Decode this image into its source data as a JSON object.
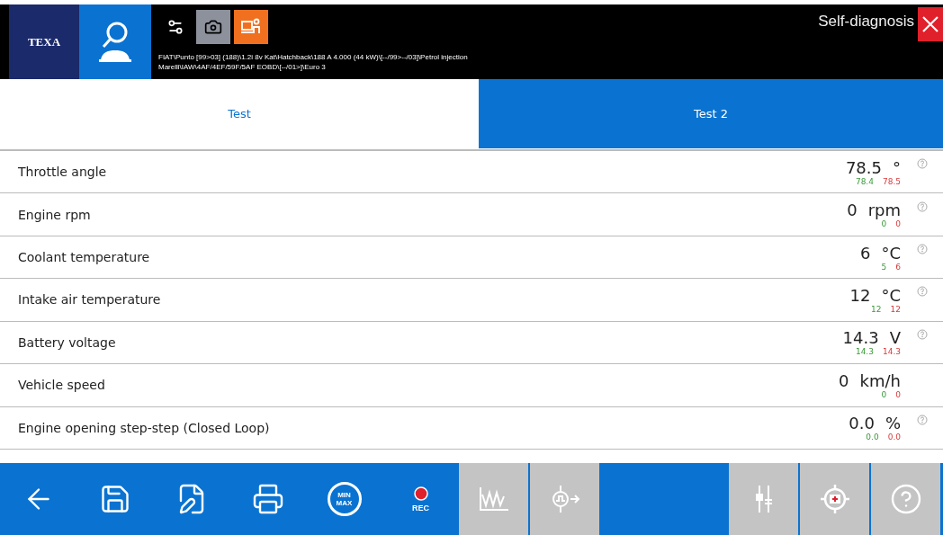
{
  "header": {
    "logo": "TEXA",
    "vehicle_lines": [
      "FIAT\\Punto  [99>03] (188)\\1.2i 8v Kat\\Hatchback\\188 A 4.000 (44 kW)\\[--/99>--/03]\\Petrol injection",
      "Marelli\\IAW\\4AF/4EF/59F/5AF EOBD\\[--/01>]\\Euro 3"
    ],
    "title": "Self-diagnosis"
  },
  "tabs": [
    {
      "label": "Test",
      "selected": true
    },
    {
      "label": "Test 2",
      "selected": false
    }
  ],
  "parameters": [
    {
      "name": "Throttle angle",
      "value": "78.5",
      "unit": "°",
      "min": "78.4",
      "max": "78.5",
      "info": true
    },
    {
      "name": "Engine rpm",
      "value": "0",
      "unit": "rpm",
      "min": "0",
      "max": "0",
      "info": true
    },
    {
      "name": "Coolant temperature",
      "value": "6",
      "unit": "°C",
      "min": "5",
      "max": "6",
      "info": true
    },
    {
      "name": "Intake air temperature",
      "value": "12",
      "unit": "°C",
      "min": "12",
      "max": "12",
      "info": true
    },
    {
      "name": "Battery voltage",
      "value": "14.3",
      "unit": "V",
      "min": "14.3",
      "max": "14.3",
      "info": true
    },
    {
      "name": "Vehicle speed",
      "value": "0",
      "unit": "km/h",
      "min": "0",
      "max": "0",
      "info": false
    },
    {
      "name": "Engine opening step-step (Closed Loop)",
      "value": "0.0",
      "unit": "%",
      "min": "0.0",
      "max": "0.0",
      "info": true
    }
  ],
  "toolbar": [
    {
      "kind": "back",
      "disabled": false
    },
    {
      "kind": "save",
      "disabled": false
    },
    {
      "kind": "edit",
      "disabled": false
    },
    {
      "kind": "print",
      "disabled": false
    },
    {
      "kind": "minmax",
      "disabled": false,
      "label": "MIN",
      "label2": "MAX"
    },
    {
      "kind": "rec",
      "disabled": false,
      "label": "REC"
    },
    {
      "kind": "graph",
      "disabled": true
    },
    {
      "kind": "signal",
      "disabled": true
    },
    {
      "kind": "spacer"
    },
    {
      "kind": "filter",
      "disabled": true
    },
    {
      "kind": "target",
      "disabled": true
    },
    {
      "kind": "help",
      "disabled": true
    }
  ]
}
